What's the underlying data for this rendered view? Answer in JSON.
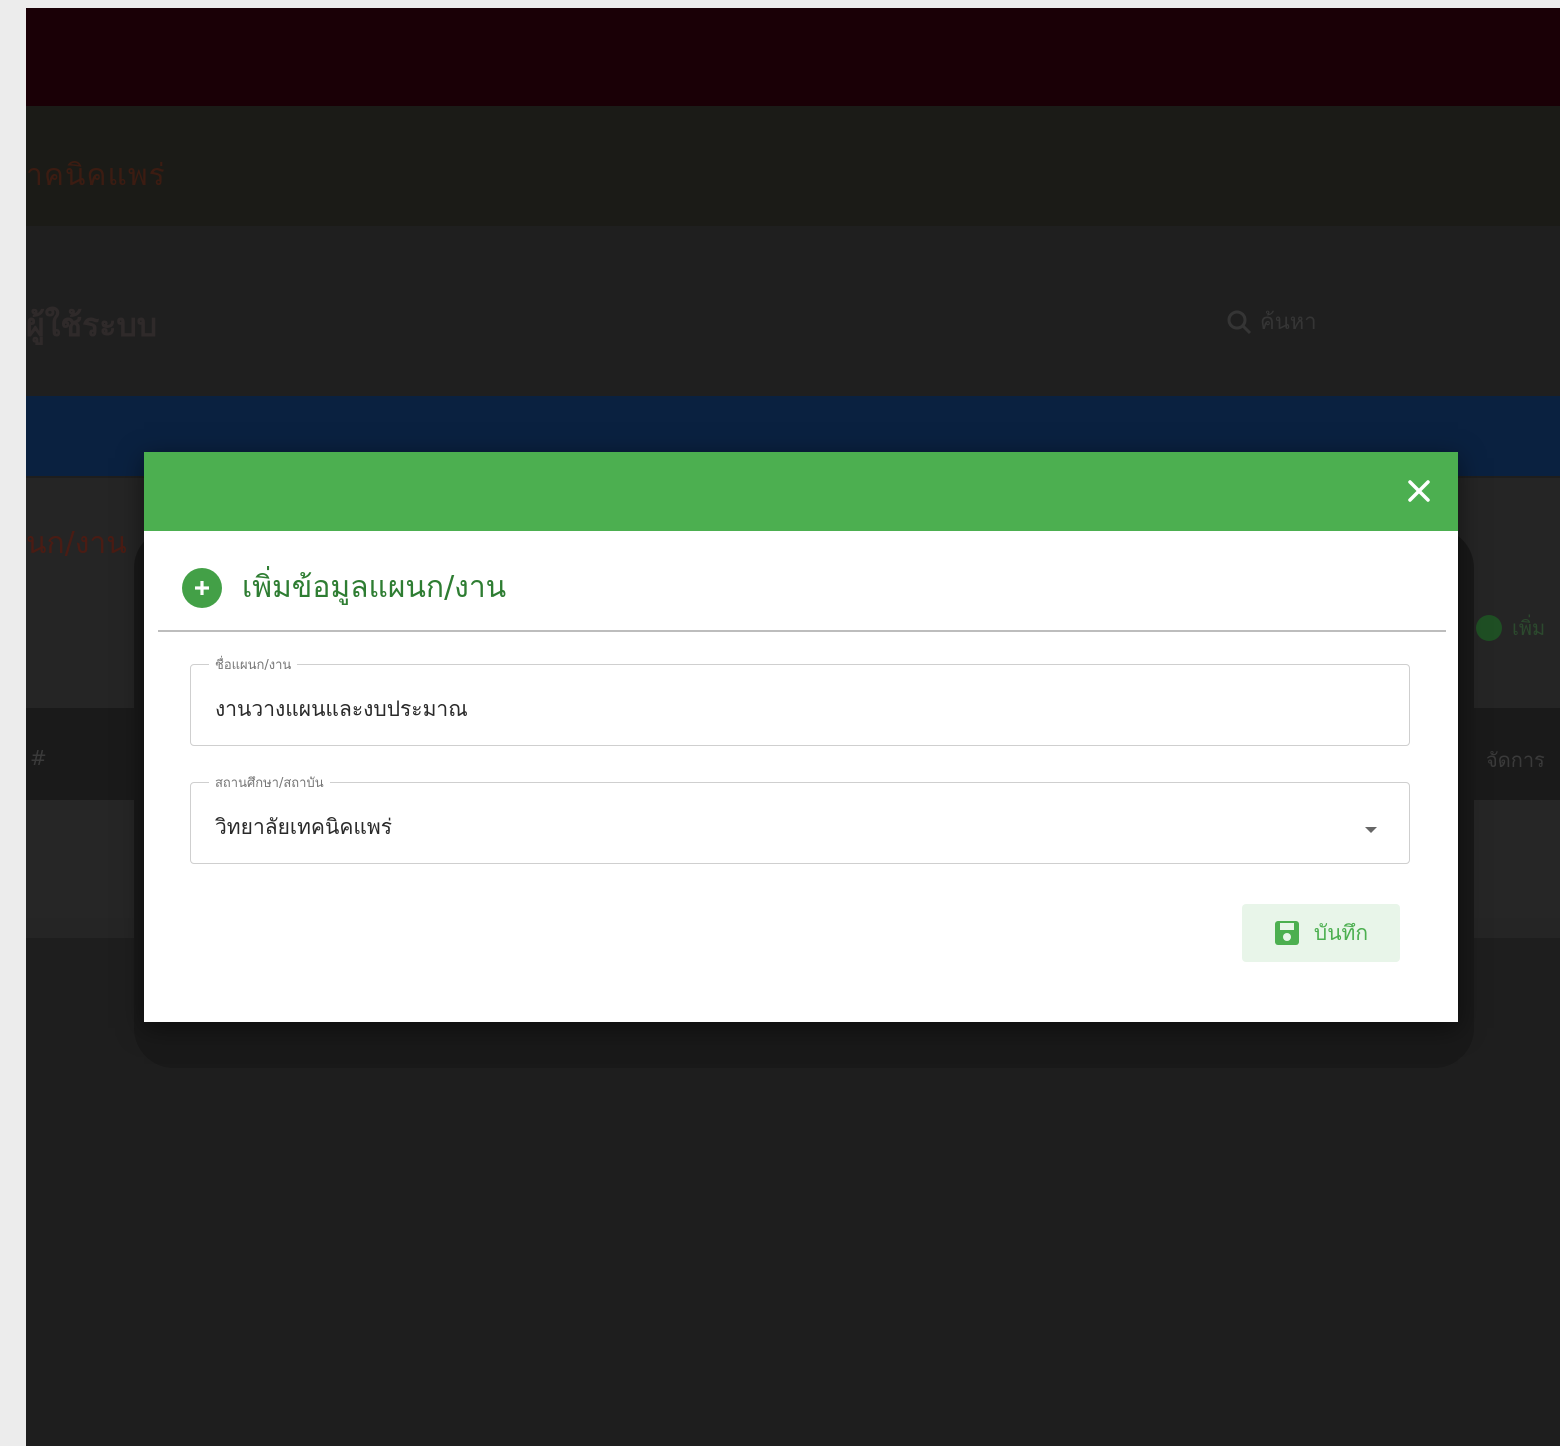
{
  "background": {
    "brand": "าคนิคแพร่",
    "page_title": "ผู้ใช้ระบบ",
    "search_label": "ค้นหา",
    "card_title": "นก/งาน",
    "card_add_label": "เพิ่ม",
    "table_headers": [
      "#",
      "จัดการ"
    ]
  },
  "modal": {
    "title": "เพิ่มข้อมูลแผนก/งาน",
    "fields": [
      {
        "label": "ชื่อแผนก/งาน",
        "value": "งานวางแผนและงบประมาณ"
      },
      {
        "label": "สถานศึกษา/สถาบัน",
        "value": "วิทยาลัยเทคนิคแพร่"
      }
    ],
    "save_label": "บันทึก"
  },
  "colors": {
    "header_green": "#4caf50",
    "title_green": "#2e7d32",
    "save_bg": "#e8f5e9"
  },
  "icons": {
    "close": "close-icon",
    "add": "add-circle-icon",
    "save": "save-icon",
    "search": "search-icon",
    "dropdown": "chevron-down-icon"
  }
}
